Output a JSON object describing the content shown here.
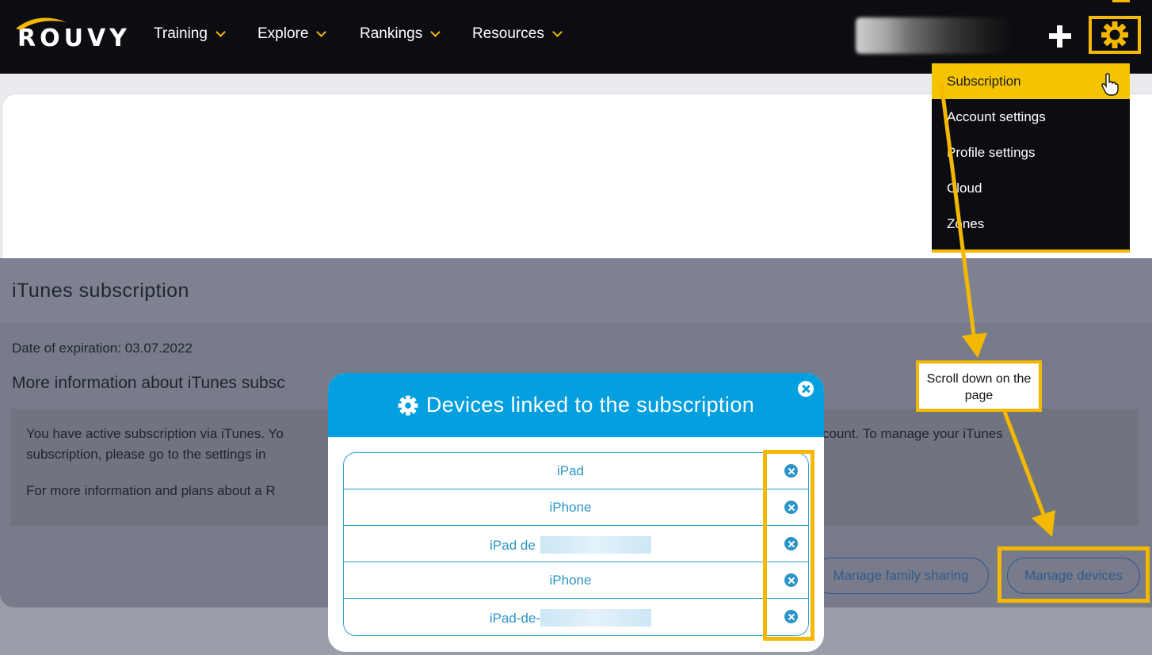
{
  "brand": {
    "logo_text": "ROUVY"
  },
  "nav": {
    "items": [
      {
        "label": "Training"
      },
      {
        "label": "Explore"
      },
      {
        "label": "Rankings"
      },
      {
        "label": "Resources"
      }
    ]
  },
  "settings_menu": {
    "items": [
      {
        "label": "Subscription",
        "active": true
      },
      {
        "label": "Account settings"
      },
      {
        "label": "Profile settings"
      },
      {
        "label": "Cloud"
      },
      {
        "label": "Zones"
      }
    ]
  },
  "subscription": {
    "title": "iTunes subscription",
    "expiration_label": "Date of expiration:",
    "expiration_date": "03.07.2022",
    "more_info_heading": "More information about iTunes subsc",
    "info_lines": [
      "You have active subscription via iTunes. Yo",
      "subscription, please go to the settings in",
      "For more information and plans about a R"
    ],
    "info_right_fragment": "count. To manage your iTunes",
    "buttons": {
      "family_sharing": "Manage family sharing",
      "manage_devices": "Manage devices"
    }
  },
  "modal": {
    "title": "Devices linked to the subscription",
    "devices": [
      {
        "name": "iPad",
        "redacted": false
      },
      {
        "name": "iPhone",
        "redacted": false
      },
      {
        "name": "iPad de",
        "redacted": true
      },
      {
        "name": "iPhone",
        "redacted": false
      },
      {
        "name": "iPad-de-",
        "redacted": true
      }
    ]
  },
  "annotation": {
    "callout_text": "Scroll down on the page"
  },
  "colors": {
    "accent": "#f5b800",
    "modal_header": "#049fde",
    "link_blue": "#2b95c6",
    "navbar_bg": "#0c0d12"
  }
}
